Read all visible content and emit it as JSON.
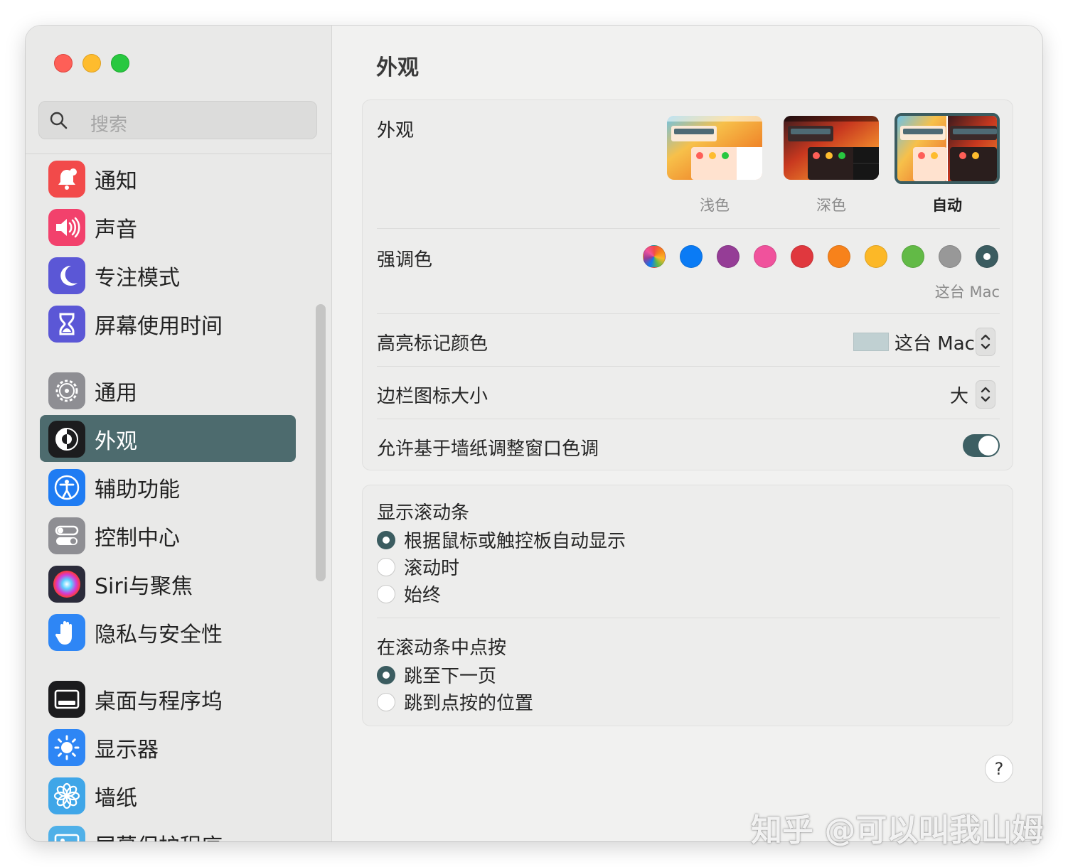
{
  "window": {
    "traffic_lights": [
      "#fe5f57",
      "#febc2e",
      "#28c840"
    ]
  },
  "sidebar": {
    "search_placeholder": "搜索",
    "items": [
      {
        "label": "通知",
        "icon": "bell-icon",
        "color": "#f24a4a"
      },
      {
        "label": "声音",
        "icon": "speaker-icon",
        "color": "#f2416c"
      },
      {
        "label": "专注模式",
        "icon": "moon-icon",
        "color": "#5b57d6"
      },
      {
        "label": "屏幕使用时间",
        "icon": "hourglass-icon",
        "color": "#5b57d6"
      },
      {
        "label": "通用",
        "icon": "gear-icon",
        "color": "#8e8e93"
      },
      {
        "label": "外观",
        "icon": "appearance-icon",
        "color": "#1c1c1e",
        "active": true
      },
      {
        "label": "辅助功能",
        "icon": "accessibility-icon",
        "color": "#1f7cf3"
      },
      {
        "label": "控制中心",
        "icon": "toggles-icon",
        "color": "#8e8e93"
      },
      {
        "label": "Siri与聚焦",
        "icon": "siri-icon",
        "color": "#2b2b3a"
      },
      {
        "label": "隐私与安全性",
        "icon": "hand-icon",
        "color": "#2e86f5"
      },
      {
        "label": "桌面与程序坞",
        "icon": "dock-icon",
        "color": "#1c1c1e"
      },
      {
        "label": "显示器",
        "icon": "sun-icon",
        "color": "#2e86f5"
      },
      {
        "label": "墙纸",
        "icon": "flower-icon",
        "color": "#3fa6e8"
      },
      {
        "label": "屏幕保护程序",
        "icon": "screensaver-icon",
        "color": "#4fb0e8"
      }
    ]
  },
  "main": {
    "title": "外观",
    "appearance": {
      "label": "外观",
      "options": [
        {
          "label": "浅色",
          "selected": false
        },
        {
          "label": "深色",
          "selected": false
        },
        {
          "label": "自动",
          "selected": true
        }
      ]
    },
    "accent": {
      "label": "强调色",
      "colors": [
        "multicolor",
        "#0a7bf5",
        "#953d96",
        "#f0529c",
        "#e0383e",
        "#f7821b",
        "#fcb827",
        "#62ba46",
        "#989898",
        "#3b5c60"
      ],
      "selected_caption": "这台 Mac"
    },
    "highlight": {
      "label": "高亮标记颜色",
      "value": "这台 Mac",
      "swatch": "#c0d0d2"
    },
    "sidebar_icon_size": {
      "label": "边栏图标大小",
      "value": "大"
    },
    "wallpaper_tinting": {
      "label": "允许基于墙纸调整窗口色调",
      "on": true
    },
    "scrollbars": {
      "label": "显示滚动条",
      "options": [
        {
          "label": "根据鼠标或触控板自动显示",
          "selected": true
        },
        {
          "label": "滚动时",
          "selected": false
        },
        {
          "label": "始终",
          "selected": false
        }
      ]
    },
    "click_scrollbar": {
      "label": "在滚动条中点按",
      "options": [
        {
          "label": "跳至下一页",
          "selected": true
        },
        {
          "label": "跳到点按的位置",
          "selected": false
        }
      ]
    },
    "help_label": "?"
  },
  "watermark": "知乎 @可以叫我山姆"
}
